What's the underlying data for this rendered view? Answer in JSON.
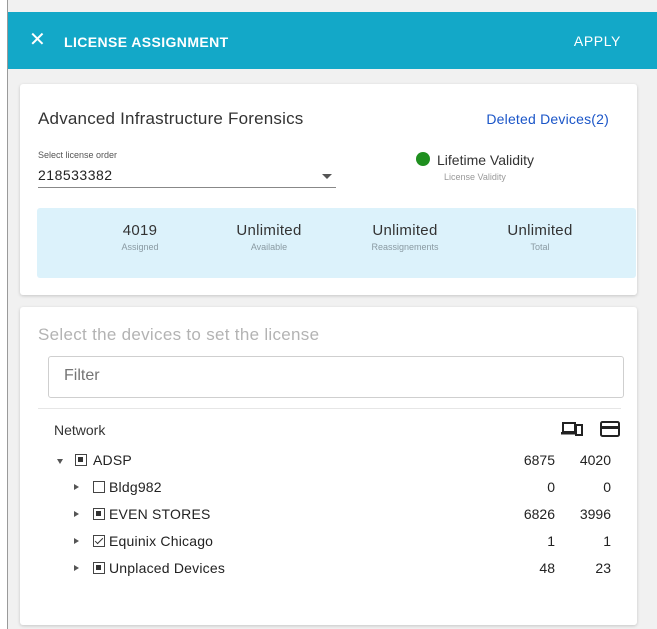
{
  "header": {
    "close_icon": "close-icon",
    "title": "LICENSE ASSIGNMENT",
    "apply_label": "APPLY",
    "bar_color": "#13a8c8"
  },
  "license": {
    "product_name": "Advanced Infrastructure Forensics",
    "deleted_devices_link": "Deleted Devices(2)",
    "select_label": "Select license order",
    "selected_order": "218533382",
    "validity_label": "Lifetime Validity",
    "validity_sub": "License Validity",
    "validity_color": "#1f8f1f",
    "stats": [
      {
        "value": "4019",
        "label": "Assigned"
      },
      {
        "value": "Unlimited",
        "label": "Available"
      },
      {
        "value": "Unlimited",
        "label": "Reassignements"
      },
      {
        "value": "Unlimited",
        "label": "Total"
      }
    ]
  },
  "devices": {
    "heading": "Select the devices to set the license",
    "filter_placeholder": "Filter",
    "column_header": "Network",
    "column_icons": [
      "devices-icon",
      "license-card-icon"
    ],
    "tree": [
      {
        "label": "ADSP",
        "expanded": true,
        "check": "mixed",
        "level": 0,
        "n1": "6875",
        "n2": "4020"
      },
      {
        "label": "Bldg982",
        "expanded": false,
        "check": "unchecked",
        "level": 1,
        "n1": "0",
        "n2": "0"
      },
      {
        "label": "EVEN STORES",
        "expanded": false,
        "check": "mixed",
        "level": 1,
        "n1": "6826",
        "n2": "3996"
      },
      {
        "label": "Equinix Chicago",
        "expanded": false,
        "check": "checked",
        "level": 1,
        "n1": "1",
        "n2": "1"
      },
      {
        "label": "Unplaced Devices",
        "expanded": false,
        "check": "mixed",
        "level": 1,
        "n1": "48",
        "n2": "23"
      }
    ]
  }
}
